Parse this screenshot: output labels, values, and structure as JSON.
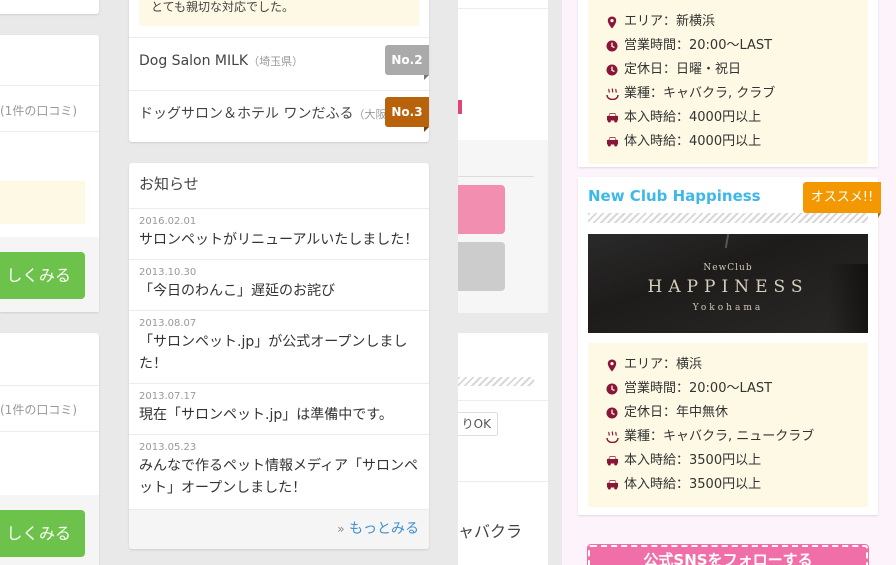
{
  "left_cards": [
    {
      "reviews_text": "(1件の口コミ)",
      "button_label": "しくみる"
    },
    {
      "reviews_text": "(1件の口コミ)",
      "button_label": "しくみる"
    }
  ],
  "ranking": {
    "top_note": "とても親切な対応でした。",
    "items": [
      {
        "name": "Dog Salon MILK",
        "pref": "（埼玉県）",
        "badge": "No.2",
        "badge_color": "#aaaaaa",
        "tail_color": "#777777"
      },
      {
        "name": "ドッグサロン＆ホテル ワンだふる",
        "pref": "（大阪",
        "badge": "No.3",
        "badge_color": "#b8620b",
        "tail_color": "#7a3f05"
      }
    ]
  },
  "news": {
    "heading": "お知らせ",
    "items": [
      {
        "date": "2016.02.01",
        "title": "サロンペットがリニューアルいたしました！"
      },
      {
        "date": "2013.10.30",
        "title": "「今日のわんこ」遅延のお詫び"
      },
      {
        "date": "2013.08.07",
        "title": "「サロンペット.jp」が公式オープンしました！"
      },
      {
        "date": "2013.07.17",
        "title": "現在「サロンペット.jp」は準備中です。"
      },
      {
        "date": "2013.05.23",
        "title": "みんなで作るペット情報メディア「サロンペット」オープンしました！"
      }
    ],
    "more_arrow": "»",
    "more_label": "もっとみる"
  },
  "center_col": {
    "tag_label": "りOK",
    "category_text": "ャバクラ"
  },
  "club1": {
    "info": [
      {
        "icon": "map-pin-icon",
        "text": "エリア：新横浜"
      },
      {
        "icon": "clock-icon",
        "text": "営業時間：20:00〜LAST"
      },
      {
        "icon": "clock-icon",
        "text": "定休日：日曜・祝日"
      },
      {
        "icon": "hot-spring-icon",
        "text": "業種：キャバクラ, クラブ"
      },
      {
        "icon": "car-icon",
        "text": "本入時給：4000円以上"
      },
      {
        "icon": "car-icon",
        "text": "体入時給：4000円以上"
      }
    ]
  },
  "club2": {
    "name": "New Club Happiness",
    "badge": "オススメ!!",
    "image": {
      "line1": "NewClub",
      "line2": "HAPPINESS",
      "line3": "Yokohama"
    },
    "info": [
      {
        "icon": "map-pin-icon",
        "text": "エリア：横浜"
      },
      {
        "icon": "clock-icon",
        "text": "営業時間：20:00〜LAST"
      },
      {
        "icon": "clock-icon",
        "text": "定休日：年中無休"
      },
      {
        "icon": "hot-spring-icon",
        "text": "業種：キャバクラ, ニュークラブ"
      },
      {
        "icon": "car-icon",
        "text": "本入時給：3500円以上"
      },
      {
        "icon": "car-icon",
        "text": "体入時給：3500円以上"
      }
    ]
  },
  "sns_button": "公式SNSをフォローする",
  "colors": {
    "accent_blue": "#3db8e8",
    "badge_orange": "#f39800",
    "icon_maroon": "#8a1538",
    "green_button": "#6cc24a",
    "pink_button": "#f28eb0",
    "sns_pink": "#f06fa8"
  }
}
